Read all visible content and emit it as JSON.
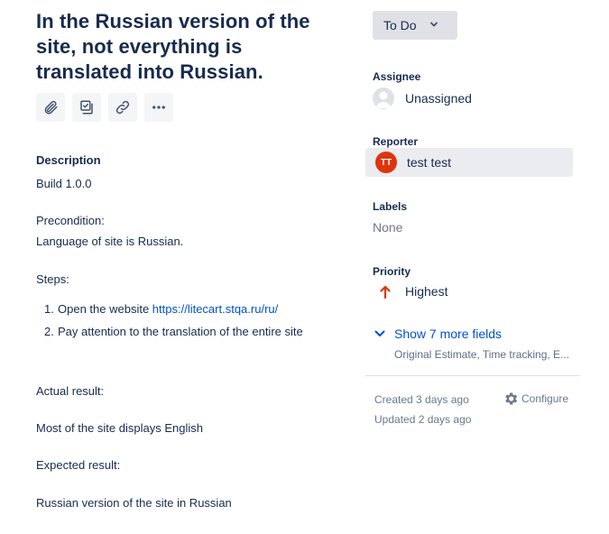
{
  "issue": {
    "title": "In the Russian version of the site, not everything is translated into Russian.",
    "actions": [
      {
        "name": "attach",
        "icon": "paperclip-icon"
      },
      {
        "name": "subtask",
        "icon": "checklist-icon"
      },
      {
        "name": "link",
        "icon": "link-icon"
      },
      {
        "name": "more",
        "icon": "more-icon"
      }
    ],
    "description_heading": "Description",
    "build": "Build 1.0.0",
    "precondition_label": "Precondition:",
    "precondition_text": "Language of site is Russian.",
    "steps_label": "Steps:",
    "steps": [
      {
        "num": "1.",
        "text": "Open the website ",
        "link": "https://litecart.stqa.ru/ru/"
      },
      {
        "num": "2.",
        "text": "Pay attention to the translation of the entire site"
      }
    ],
    "actual_label": "Actual result:",
    "actual_text": "Most of the site displays English",
    "expected_label": "Expected result:",
    "expected_text": "Russian version of the site in Russian"
  },
  "sidebar": {
    "status": "To Do",
    "assignee_label": "Assignee",
    "assignee_value": "Unassigned",
    "reporter_label": "Reporter",
    "reporter_initials": "TT",
    "reporter_name": "test test",
    "labels_label": "Labels",
    "labels_value": "None",
    "priority_label": "Priority",
    "priority_value": "Highest",
    "more_fields_label": "Show 7 more fields",
    "more_fields_sub": "Original Estimate, Time tracking, E...",
    "created": "Created 3 days ago",
    "updated": "Updated 2 days ago",
    "configure": "Configure"
  },
  "colors": {
    "link": "#0052cc",
    "priority_highest": "#de350b",
    "avatar_reporter": "#de350b",
    "status_bg": "#dfe1e6"
  }
}
